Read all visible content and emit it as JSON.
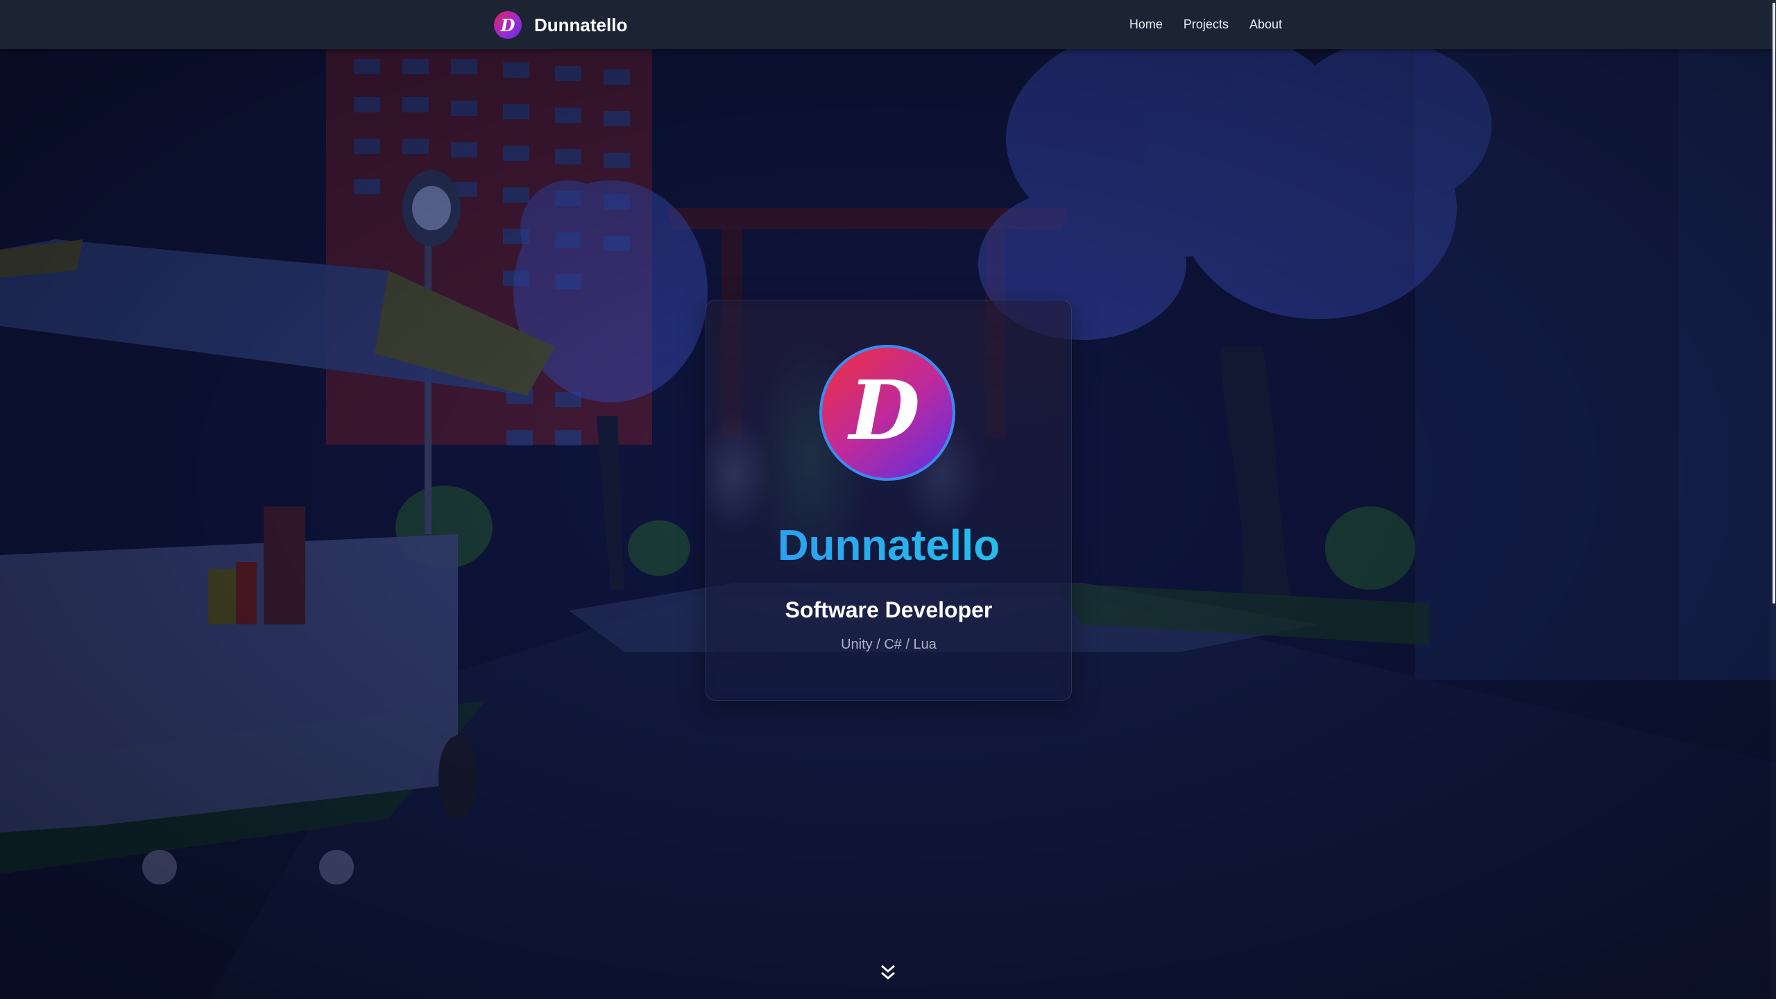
{
  "navbar": {
    "brand_logo_letter": "D",
    "brand_name": "Dunnatello",
    "links": [
      {
        "label": "Home"
      },
      {
        "label": "Projects"
      },
      {
        "label": "About"
      }
    ]
  },
  "hero": {
    "avatar_letter": "D",
    "name": "Dunnatello",
    "role": "Software Developer",
    "tech": "Unity / C# / Lua"
  },
  "icons": {
    "scroll_down": "chevron-double-down-icon",
    "brand_logo": "letter-d-logo"
  },
  "colors": {
    "navbar_bg": "#1c2433",
    "name_gradient_start": "#2f97ee",
    "name_gradient_end": "#22c7ee",
    "avatar_gradient_start": "#f0303c",
    "avatar_gradient_end": "#5a2fe6",
    "avatar_border": "#3b8cf0"
  }
}
